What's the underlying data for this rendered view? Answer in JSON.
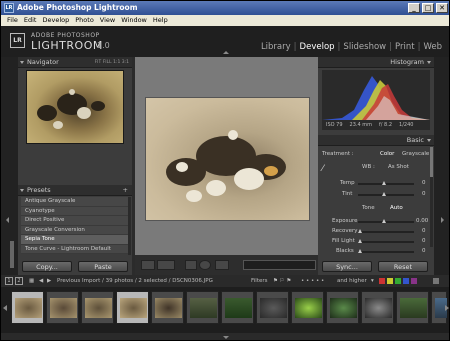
{
  "window": {
    "title": "Adobe Photoshop Lightroom",
    "controls": [
      "_",
      "□",
      "✕"
    ]
  },
  "menu": [
    "File",
    "Edit",
    "Develop",
    "Photo",
    "View",
    "Window",
    "Help"
  ],
  "brand": {
    "badge": "LR",
    "top": "ADOBE PHOTOSHOP",
    "main": "LIGHTROOM",
    "version": "1.0"
  },
  "modules": [
    "Library",
    "Develop",
    "Slideshow",
    "Print",
    "Web"
  ],
  "active_module": "Develop",
  "navigator": {
    "title": "Navigator",
    "zoom_options": [
      "FIT",
      "FILL",
      "1:1",
      "3:1"
    ]
  },
  "presets": {
    "title": "Presets",
    "items": [
      "Antique Grayscale",
      "Cyanotype",
      "Direct Positive",
      "Grayscale Conversion",
      "Sepia Tone",
      "Tone Curve - Lightroom Default"
    ],
    "selected_index": 4
  },
  "left_buttons": {
    "copy": "Copy...",
    "paste": "Paste"
  },
  "histogram": {
    "title": "Histogram",
    "iso": "ISO 79",
    "focal": "23.4 mm",
    "aperture": "f/ 8.2",
    "shutter": "1/240"
  },
  "basic": {
    "title": "Basic",
    "treatment_label": "Treatment :",
    "color_label": "Color",
    "grayscale_label": "Grayscale",
    "wb_label": "WB :",
    "wb_value": "As Shot",
    "temp_label": "Temp",
    "temp_value": "0",
    "tint_label": "Tint",
    "tint_value": "0",
    "tone_label": "Tone",
    "tone_auto": "Auto",
    "exposure_label": "Exposure",
    "exposure_value": "0.00",
    "recovery_label": "Recovery",
    "recovery_value": "0",
    "filllight_label": "Fill Light",
    "filllight_value": "0",
    "blacks_label": "Blacks",
    "blacks_value": "0"
  },
  "right_buttons": {
    "sync": "Sync...",
    "reset": "Reset"
  },
  "filmstrip": {
    "info": "Previous Import / 39 photos / 2 selected / DSCN0306.JPG",
    "filters_label": "Filters",
    "rating_label": "and higher",
    "page_num": "1",
    "page_num_2": "2"
  },
  "colors": {
    "accent": "#ffffff",
    "panel": "#3c3c3c",
    "titlebar": "#2f4f93"
  }
}
